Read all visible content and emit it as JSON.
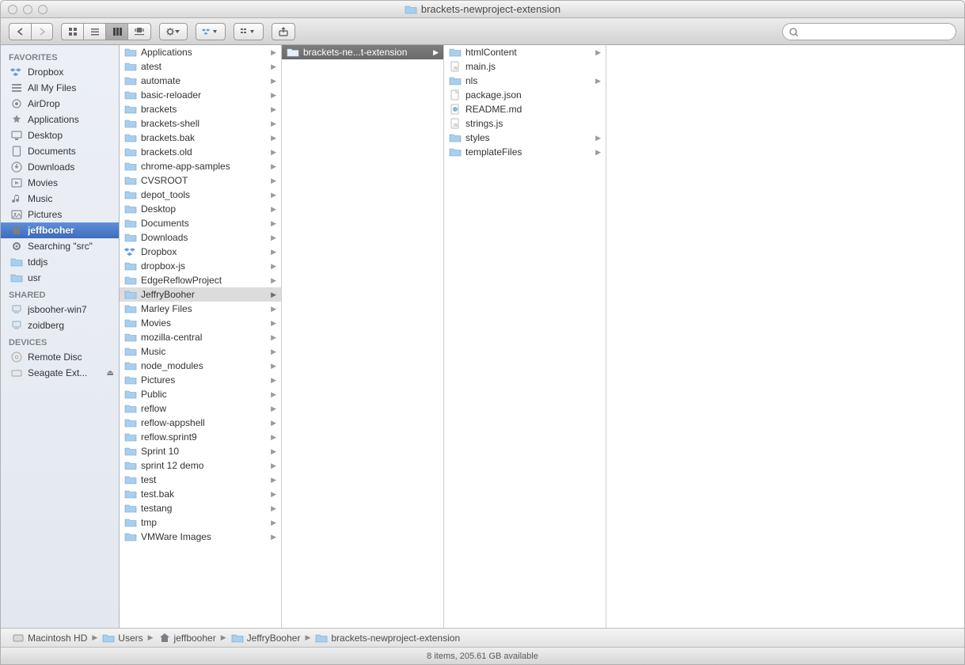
{
  "window_title": "brackets-newproject-extension",
  "search_placeholder": "",
  "sidebar": {
    "sections": [
      {
        "title": "FAVORITES",
        "items": [
          {
            "icon": "dropbox",
            "label": "Dropbox"
          },
          {
            "icon": "allfiles",
            "label": "All My Files"
          },
          {
            "icon": "airdrop",
            "label": "AirDrop"
          },
          {
            "icon": "apps",
            "label": "Applications"
          },
          {
            "icon": "desktop",
            "label": "Desktop"
          },
          {
            "icon": "documents",
            "label": "Documents"
          },
          {
            "icon": "downloads",
            "label": "Downloads"
          },
          {
            "icon": "movies",
            "label": "Movies"
          },
          {
            "icon": "music",
            "label": "Music"
          },
          {
            "icon": "pictures",
            "label": "Pictures"
          },
          {
            "icon": "home",
            "label": "jeffbooher",
            "selected": true
          },
          {
            "icon": "gear",
            "label": "Searching \"src\""
          },
          {
            "icon": "folder",
            "label": "tddjs"
          },
          {
            "icon": "folder",
            "label": "usr"
          }
        ]
      },
      {
        "title": "SHARED",
        "items": [
          {
            "icon": "pc",
            "label": "jsbooher-win7"
          },
          {
            "icon": "pc",
            "label": "zoidberg"
          }
        ]
      },
      {
        "title": "DEVICES",
        "items": [
          {
            "icon": "disc",
            "label": "Remote Disc"
          },
          {
            "icon": "drive",
            "label": "Seagate Ext...",
            "eject": true
          }
        ]
      }
    ]
  },
  "columns": [
    [
      {
        "type": "folder",
        "label": "Applications",
        "arrow": true
      },
      {
        "type": "folder",
        "label": "atest",
        "arrow": true
      },
      {
        "type": "folder",
        "label": "automate",
        "arrow": true
      },
      {
        "type": "folder",
        "label": "basic-reloader",
        "arrow": true
      },
      {
        "type": "folder",
        "label": "brackets",
        "arrow": true
      },
      {
        "type": "folder",
        "label": "brackets-shell",
        "arrow": true
      },
      {
        "type": "folder",
        "label": "brackets.bak",
        "arrow": true
      },
      {
        "type": "folder",
        "label": "brackets.old",
        "arrow": true
      },
      {
        "type": "folder",
        "label": "chrome-app-samples",
        "arrow": true
      },
      {
        "type": "folder",
        "label": "CVSROOT",
        "arrow": true
      },
      {
        "type": "folder",
        "label": "depot_tools",
        "arrow": true
      },
      {
        "type": "folder",
        "label": "Desktop",
        "arrow": true
      },
      {
        "type": "folder",
        "label": "Documents",
        "arrow": true
      },
      {
        "type": "folder",
        "label": "Downloads",
        "arrow": true
      },
      {
        "type": "dropbox",
        "label": "Dropbox",
        "arrow": true
      },
      {
        "type": "folder",
        "label": "dropbox-js",
        "arrow": true
      },
      {
        "type": "folder",
        "label": "EdgeReflowProject",
        "arrow": true
      },
      {
        "type": "folder",
        "label": "JeffryBooher",
        "arrow": true,
        "active": true
      },
      {
        "type": "folder",
        "label": "Marley Files",
        "arrow": true
      },
      {
        "type": "folder",
        "label": "Movies",
        "arrow": true
      },
      {
        "type": "folder",
        "label": "mozilla-central",
        "arrow": true
      },
      {
        "type": "folder",
        "label": "Music",
        "arrow": true
      },
      {
        "type": "folder",
        "label": "node_modules",
        "arrow": true
      },
      {
        "type": "folder",
        "label": "Pictures",
        "arrow": true
      },
      {
        "type": "folder",
        "label": "Public",
        "arrow": true
      },
      {
        "type": "folder",
        "label": "reflow",
        "arrow": true
      },
      {
        "type": "folder",
        "label": "reflow-appshell",
        "arrow": true
      },
      {
        "type": "folder",
        "label": "reflow.sprint9",
        "arrow": true
      },
      {
        "type": "folder",
        "label": "Sprint 10",
        "arrow": true
      },
      {
        "type": "folder",
        "label": "sprint 12 demo",
        "arrow": true
      },
      {
        "type": "folder",
        "label": "test",
        "arrow": true
      },
      {
        "type": "folder",
        "label": "test.bak",
        "arrow": true
      },
      {
        "type": "folder",
        "label": "testang",
        "arrow": true
      },
      {
        "type": "folder",
        "label": "tmp",
        "arrow": true
      },
      {
        "type": "folder",
        "label": "VMWare Images",
        "arrow": true
      }
    ],
    [
      {
        "type": "folder",
        "label": "brackets-ne...t-extension",
        "arrow": true,
        "selected": true
      }
    ],
    [
      {
        "type": "folder",
        "label": "htmlContent",
        "arrow": true
      },
      {
        "type": "js",
        "label": "main.js"
      },
      {
        "type": "folder",
        "label": "nls",
        "arrow": true
      },
      {
        "type": "file",
        "label": "package.json"
      },
      {
        "type": "md",
        "label": "README.md"
      },
      {
        "type": "js",
        "label": "strings.js"
      },
      {
        "type": "folder",
        "label": "styles",
        "arrow": true
      },
      {
        "type": "folder",
        "label": "templateFiles",
        "arrow": true
      }
    ],
    []
  ],
  "path": [
    {
      "icon": "hd",
      "label": "Macintosh HD"
    },
    {
      "icon": "folder",
      "label": "Users"
    },
    {
      "icon": "home",
      "label": "jeffbooher"
    },
    {
      "icon": "folder",
      "label": "JeffryBooher"
    },
    {
      "icon": "folder",
      "label": "brackets-newproject-extension"
    }
  ],
  "status": "8 items, 205.61 GB available"
}
